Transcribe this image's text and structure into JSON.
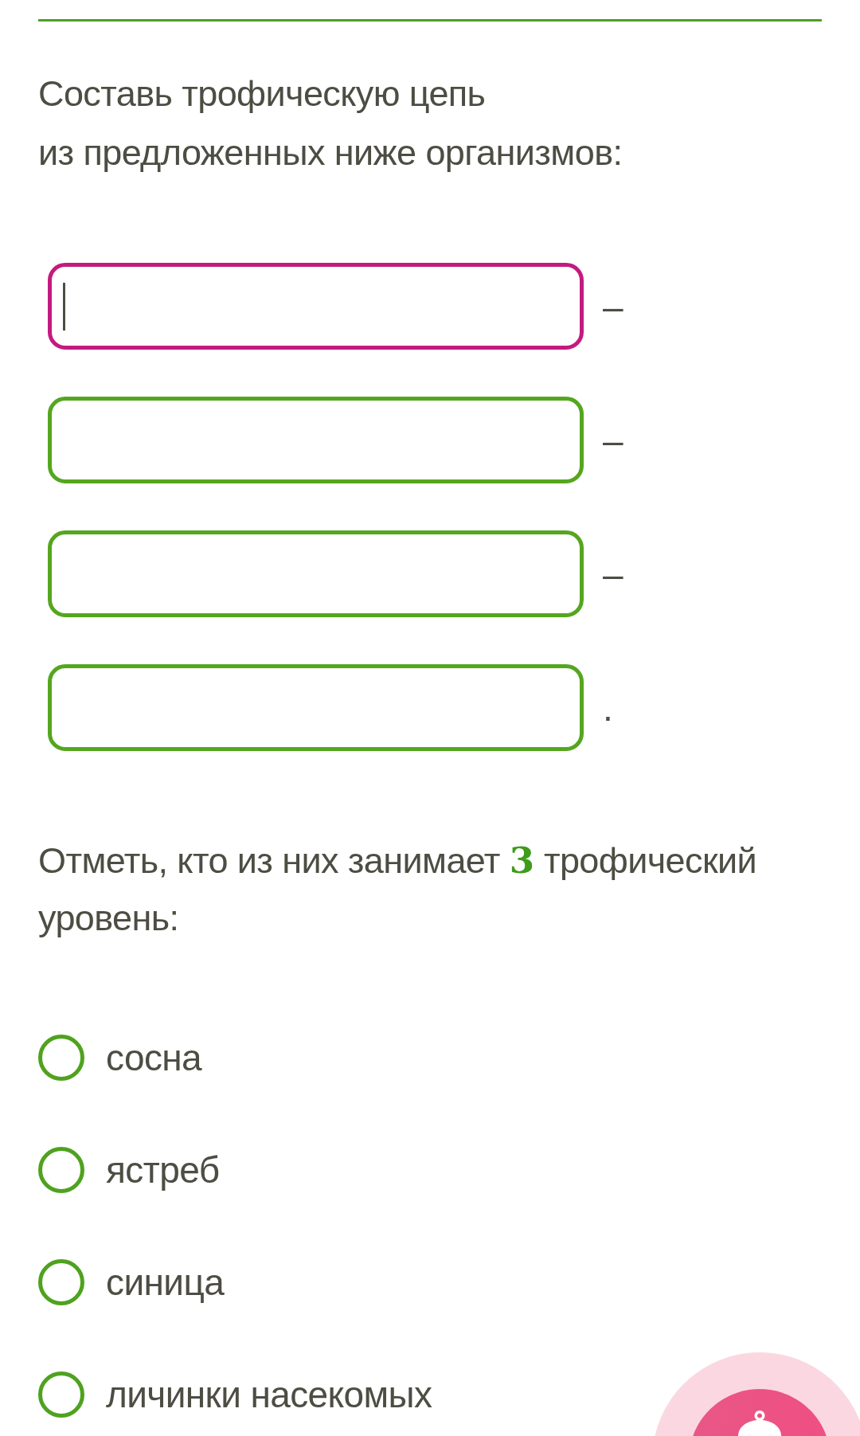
{
  "heading": {
    "text": "Составь трофическую цепь\nиз предложенных ниже организмов:"
  },
  "chain": {
    "slots": [
      {
        "focused": true,
        "separator": "–"
      },
      {
        "focused": false,
        "separator": "–"
      },
      {
        "focused": false,
        "separator": "–"
      },
      {
        "focused": false,
        "separator": "."
      }
    ]
  },
  "question": {
    "text": "Отметь, кто из них занимает **3** трофический уровень:"
  },
  "options": [
    {
      "label": "сосна",
      "selected": false
    },
    {
      "label": "ястреб",
      "selected": false
    },
    {
      "label": "синица",
      "selected": false
    },
    {
      "label": "личинки насекомых",
      "selected": false
    }
  ]
}
